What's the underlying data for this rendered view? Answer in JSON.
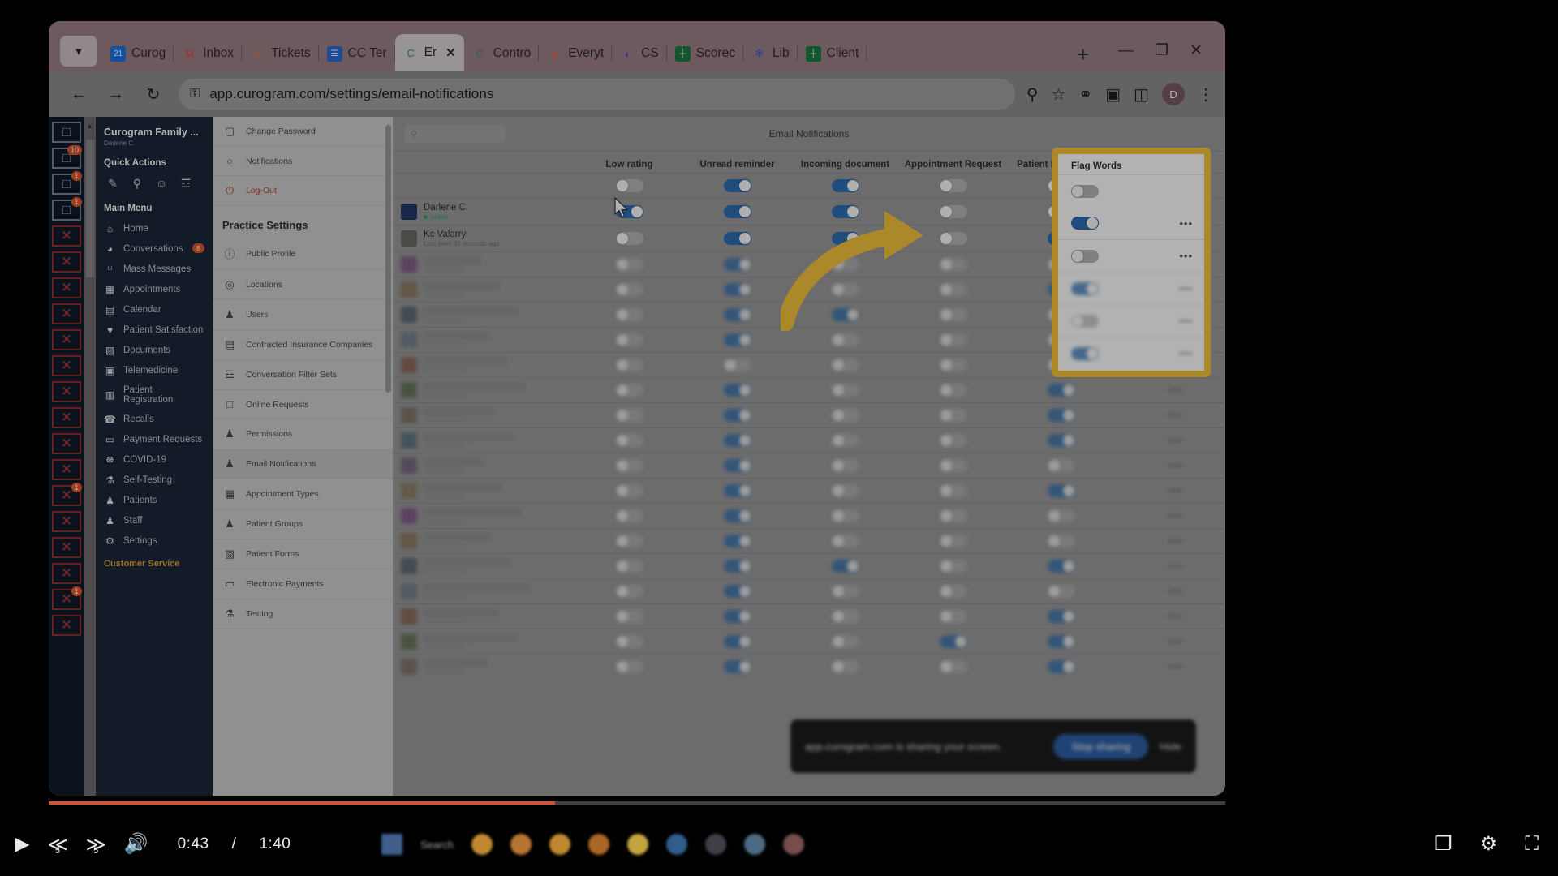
{
  "browser": {
    "tabs": [
      {
        "label": "Curog",
        "icon": "calendar-21-icon",
        "active": false
      },
      {
        "label": "Inbox",
        "icon": "gmail-icon",
        "active": false
      },
      {
        "label": "Tickets",
        "icon": "ticket-icon",
        "active": false
      },
      {
        "label": "CC Ter",
        "icon": "doc-blue-icon",
        "active": false
      },
      {
        "label": "Er",
        "icon": "curogram-icon",
        "active": true
      },
      {
        "label": "Contro",
        "icon": "curogram-icon",
        "active": false
      },
      {
        "label": "Everyt",
        "icon": "everything-icon",
        "active": false
      },
      {
        "label": "CS",
        "icon": "venn-icon",
        "active": false
      },
      {
        "label": "Scorec",
        "icon": "sheets-icon",
        "active": false
      },
      {
        "label": "Lib",
        "icon": "asterisk-icon",
        "active": false
      },
      {
        "label": "Client",
        "icon": "sheets-icon",
        "active": false
      }
    ],
    "new_tab_label": "+",
    "window_controls": {
      "minimize": "—",
      "maximize": "❐",
      "close": "✕"
    },
    "url": "app.curogram.com/settings/email-notifications",
    "back_label": "←",
    "forward_label": "→",
    "reload_label": "↻",
    "site_info_label": "⚿",
    "zoom_icon": "search-zoom-icon",
    "bookmark_icon": "star-icon",
    "shield_icon": "shield-icon",
    "extensions_icon": "puzzle-icon",
    "sidepanel_icon": "side-panel-icon",
    "profile_initial": "D",
    "menu_icon": "⋮"
  },
  "sidenav": {
    "org_name": "Curogram Family ...",
    "org_user": "Darlene C.",
    "quick_actions_title": "Quick Actions",
    "quick_actions": [
      {
        "name": "compose-icon",
        "glyph": "✎"
      },
      {
        "name": "search-icon",
        "glyph": "⚲"
      },
      {
        "name": "add-patient-icon",
        "glyph": "☺"
      },
      {
        "name": "filters-icon",
        "glyph": "☲"
      }
    ],
    "main_menu_title": "Main Menu",
    "items": [
      {
        "label": "Home",
        "icon": "home-icon",
        "glyph": "⌂",
        "badge": ""
      },
      {
        "label": "Conversations",
        "icon": "chat-icon",
        "glyph": "◕",
        "badge": "8"
      },
      {
        "label": "Mass Messages",
        "icon": "broadcast-icon",
        "glyph": "⑂",
        "badge": ""
      },
      {
        "label": "Appointments",
        "icon": "appointments-icon",
        "glyph": "▦",
        "badge": ""
      },
      {
        "label": "Calendar",
        "icon": "calendar-icon",
        "glyph": "▤",
        "badge": ""
      },
      {
        "label": "Patient Satisfaction",
        "icon": "heart-icon",
        "glyph": "♥",
        "badge": ""
      },
      {
        "label": "Documents",
        "icon": "documents-icon",
        "glyph": "▧",
        "badge": ""
      },
      {
        "label": "Telemedicine",
        "icon": "telemedicine-icon",
        "glyph": "▣",
        "badge": ""
      },
      {
        "label": "Patient Registration",
        "icon": "registration-icon",
        "glyph": "▥",
        "badge": ""
      },
      {
        "label": "Recalls",
        "icon": "phone-recall-icon",
        "glyph": "☎",
        "badge": ""
      },
      {
        "label": "Payment Requests",
        "icon": "credit-card-icon",
        "glyph": "▭",
        "badge": ""
      },
      {
        "label": "COVID-19",
        "icon": "virus-icon",
        "glyph": "☸",
        "badge": ""
      },
      {
        "label": "Self-Testing",
        "icon": "flask-icon",
        "glyph": "⚗",
        "badge": ""
      },
      {
        "label": "Patients",
        "icon": "patient-icon",
        "glyph": "♟",
        "badge": ""
      },
      {
        "label": "Staff",
        "icon": "staff-icon",
        "glyph": "♟",
        "badge": ""
      },
      {
        "label": "Settings",
        "icon": "gear-icon",
        "glyph": "⚙",
        "badge": ""
      }
    ],
    "footer_label": "Customer Service"
  },
  "settingsnav": {
    "top_items": [
      {
        "label": "Change Password",
        "icon": "lock-icon",
        "glyph": "▢",
        "active": false
      },
      {
        "label": "Notifications",
        "icon": "bell-icon",
        "glyph": "○",
        "active": false
      },
      {
        "label": "Log-Out",
        "icon": "power-icon",
        "glyph": "⏻",
        "active": false
      }
    ],
    "section_title": "Practice Settings",
    "items": [
      {
        "label": "Public Profile",
        "icon": "info-icon",
        "glyph": "ⓘ",
        "active": false
      },
      {
        "label": "Locations",
        "icon": "pin-icon",
        "glyph": "◎",
        "active": false
      },
      {
        "label": "Users",
        "icon": "users-icon",
        "glyph": "♟",
        "active": false
      },
      {
        "label": "Contracted Insurance Companies",
        "icon": "id-card-icon",
        "glyph": "▤",
        "active": false
      },
      {
        "label": "Conversation Filter Sets",
        "icon": "sliders-icon",
        "glyph": "☲",
        "active": false
      },
      {
        "label": "Online Requests",
        "icon": "inbox-person-icon",
        "glyph": "□",
        "active": false
      },
      {
        "label": "Permissions",
        "icon": "permissions-icon",
        "glyph": "♟",
        "active": false
      },
      {
        "label": "Email Notifications",
        "icon": "email-notifications-icon",
        "glyph": "♟",
        "active": true
      },
      {
        "label": "Appointment Types",
        "icon": "calendar-types-icon",
        "glyph": "▦",
        "active": false
      },
      {
        "label": "Patient Groups",
        "icon": "patient-groups-icon",
        "glyph": "♟",
        "active": false
      },
      {
        "label": "Patient Forms",
        "icon": "forms-icon",
        "glyph": "▧",
        "active": false
      },
      {
        "label": "Electronic Payments",
        "icon": "payments-icon",
        "glyph": "▭",
        "active": false
      },
      {
        "label": "Testing",
        "icon": "testing-icon",
        "glyph": "⚗",
        "active": false
      }
    ]
  },
  "content": {
    "search_placeholder": "",
    "search_icon": "search-icon",
    "page_title": "Email Notifications",
    "columns": [
      "Low rating",
      "Unread reminder",
      "Incoming document",
      "Appointment Request",
      "Patient Registration"
    ],
    "header_toggles": [
      false,
      true,
      true,
      false,
      false
    ],
    "rows": [
      {
        "name": "Darlene C.",
        "status": "online",
        "status_type": "online",
        "avatar_color": "#24376b",
        "toggles": [
          true,
          true,
          true,
          false,
          false
        ],
        "flag_words": true,
        "menu": "•••"
      },
      {
        "name": "Kc Valarry",
        "status": "Last seen 37 seconds ago",
        "status_type": "offline",
        "avatar_color": "#6d6a66",
        "toggles": [
          false,
          true,
          true,
          false,
          true
        ],
        "flag_words": false,
        "menu": "•••"
      }
    ],
    "blurred_rows": [
      {
        "toggles": [
          false,
          true,
          false,
          false,
          false
        ],
        "flag_words": true
      },
      {
        "toggles": [
          false,
          true,
          false,
          false,
          true
        ],
        "flag_words": false
      },
      {
        "toggles": [
          false,
          true,
          true,
          false,
          false
        ],
        "flag_words": true
      },
      {
        "toggles": [
          false,
          true,
          false,
          false,
          false
        ],
        "flag_words": false
      },
      {
        "toggles": [
          false,
          false,
          false,
          false,
          false
        ],
        "flag_words": false
      },
      {
        "toggles": [
          false,
          true,
          false,
          false,
          true
        ],
        "flag_words": false
      },
      {
        "toggles": [
          false,
          true,
          false,
          false,
          true
        ],
        "flag_words": false
      },
      {
        "toggles": [
          false,
          true,
          false,
          false,
          true
        ],
        "flag_words": false
      },
      {
        "toggles": [
          false,
          true,
          false,
          false,
          false
        ],
        "flag_words": false
      },
      {
        "toggles": [
          false,
          true,
          false,
          false,
          true
        ],
        "flag_words": false
      },
      {
        "toggles": [
          false,
          true,
          false,
          false,
          false
        ],
        "flag_words": false
      },
      {
        "toggles": [
          false,
          true,
          false,
          false,
          false
        ],
        "flag_words": false
      },
      {
        "toggles": [
          false,
          true,
          true,
          false,
          true
        ],
        "flag_words": false
      },
      {
        "toggles": [
          false,
          true,
          false,
          false,
          false
        ],
        "flag_words": false
      },
      {
        "toggles": [
          false,
          true,
          false,
          false,
          true
        ],
        "flag_words": false
      },
      {
        "toggles": [
          false,
          true,
          false,
          true,
          true
        ],
        "flag_words": true
      },
      {
        "toggles": [
          false,
          true,
          false,
          false,
          true
        ],
        "flag_words": false
      }
    ],
    "share_banner": {
      "text": "app.curogram.com is sharing your screen.",
      "stop_label": "Stop sharing",
      "hide_label": "Hide"
    }
  },
  "flag_panel": {
    "title": "Flag Words",
    "header_toggle": false,
    "rows": [
      {
        "toggle": true,
        "menu": "•••"
      },
      {
        "toggle": false,
        "menu": "•••"
      },
      {
        "toggle": true,
        "menu": "•••"
      },
      {
        "toggle": false,
        "menu": "•••"
      },
      {
        "toggle": true,
        "menu": "•••"
      }
    ],
    "highlight_color": "#f5c33b"
  },
  "annotation": {
    "arrow_color": "#f5c33b",
    "arrow_name": "yellow-pointer-arrow"
  },
  "player": {
    "play_label": "▶",
    "rewind_label": "≪",
    "rewind_seconds": "5",
    "forward_label": "≫",
    "forward_seconds": "5",
    "volume_label": "🔊",
    "current_time": "0:43",
    "separator": "/",
    "duration": "1:40",
    "progress_percent": 43,
    "pip_label": "❐",
    "settings_label": "⚙",
    "fullscreen_label": "⛶"
  }
}
